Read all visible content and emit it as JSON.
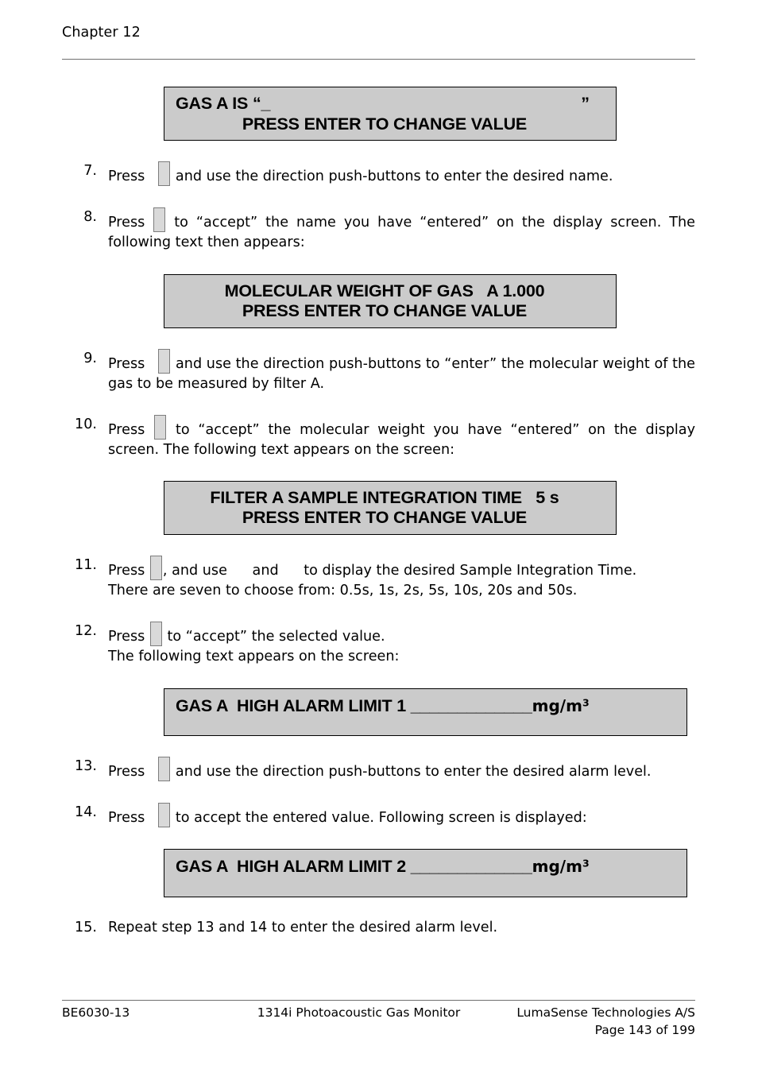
{
  "header": {
    "chapter": "Chapter 12"
  },
  "displays": {
    "gas_name": {
      "line1_prefix": "GAS A IS “_",
      "line1_close_quote": "”",
      "line2": "PRESS ENTER TO CHANGE VALUE"
    },
    "molecular_weight": {
      "line1": "MOLECULAR WEIGHT OF GAS   A 1.000",
      "line2": "PRESS ENTER TO CHANGE VALUE"
    },
    "integration_time": {
      "line1": "FILTER A SAMPLE INTEGRATION TIME   5 s",
      "line2": "PRESS ENTER TO CHANGE VALUE"
    },
    "alarm_limit_1": {
      "line1": "GAS A  HIGH ALARM LIMIT 1 _____________",
      "unit": "mg/m",
      "unit_sup": "3"
    },
    "alarm_limit_2": {
      "line1": "GAS A  HIGH ALARM LIMIT 2 _____________",
      "unit": "mg/m",
      "unit_sup": "3"
    }
  },
  "steps": {
    "s7": {
      "num": "7.",
      "pre": "Press",
      "post": "and use the direction push-buttons to enter the desired name."
    },
    "s8": {
      "num": "8.",
      "pre": "Press",
      "post": "to “accept” the name you have “entered” on the display screen. The following text then appears:"
    },
    "s9": {
      "num": "9.",
      "pre": "Press",
      "post": "and use the direction push-buttons to “enter” the molecular weight of the gas to be measured by filter A."
    },
    "s10": {
      "num": "10.",
      "pre": "Press",
      "post": "to “accept” the molecular weight you have “entered” on the display screen. The following text appears on the screen:"
    },
    "s11": {
      "num": "11.",
      "pre": "Press",
      "mid1": ", and use",
      "mid2": "and",
      "post": "to display the desired Sample Integration Time.",
      "line3": "There are seven to choose from: 0.5s, 1s, 2s, 5s, 10s, 20s and 50s."
    },
    "s12": {
      "num": "12.",
      "pre": "Press",
      "post": "to “accept” the selected value.",
      "line2": "The following text appears on the screen:"
    },
    "s13": {
      "num": "13.",
      "pre": "Press",
      "post": "and use the direction push-buttons to enter the desired alarm level."
    },
    "s14": {
      "num": "14.",
      "pre": "Press",
      "post": "to accept the entered value. Following screen is displayed:"
    },
    "s15": {
      "num": "15.",
      "text": "Repeat step 13 and 14 to enter the desired alarm level."
    }
  },
  "footer": {
    "doc_number": "BE6030-13",
    "product": "1314i Photoacoustic Gas Monitor",
    "company": "LumaSense Technologies A/S",
    "page": "Page 143 of 199"
  }
}
